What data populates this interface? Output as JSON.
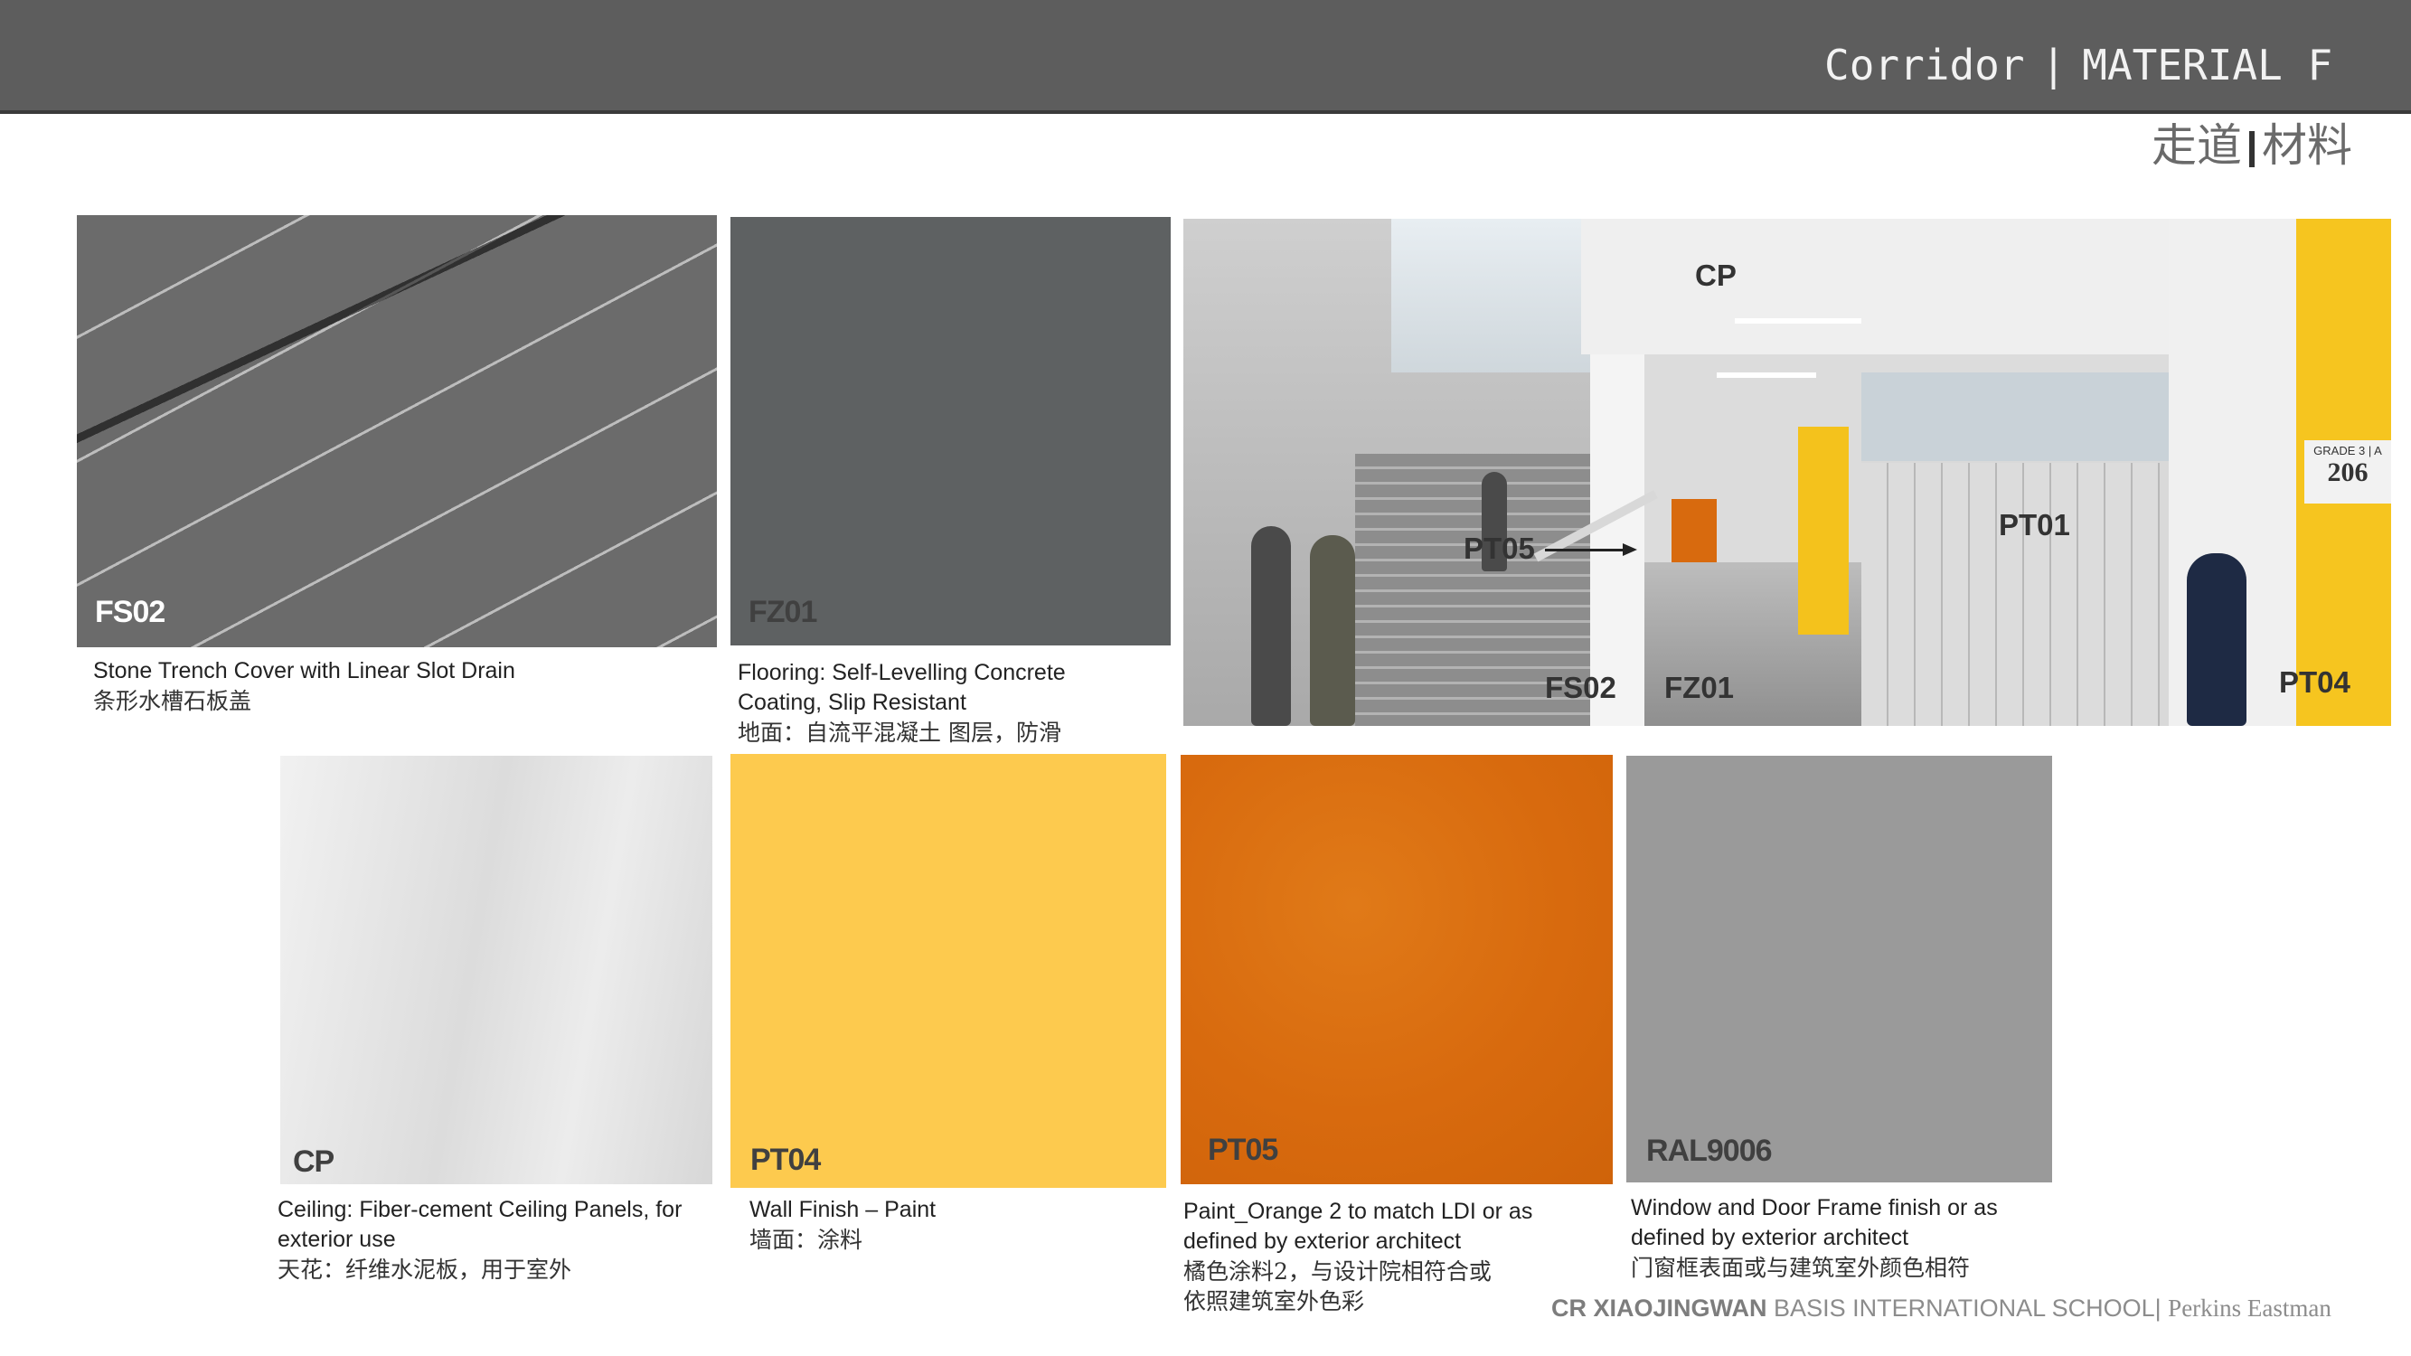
{
  "header": {
    "title_en_a": "Corridor",
    "title_sep": "|",
    "title_en_b": "MATERIAL FINISH",
    "title_cn_a": "走道",
    "title_cn_b": "材料"
  },
  "materials": [
    {
      "code": "FS02",
      "caption_en": "Stone Trench Cover with Linear Slot Drain",
      "caption_cn": "条形水槽石板盖"
    },
    {
      "code": "FZ01",
      "caption_en_1": "Flooring:   Self-Levelling Concrete",
      "caption_en_2": "Coating, Slip Resistant",
      "caption_cn": "地面：自流平混凝土 图层，防滑"
    },
    {
      "code": "CP",
      "caption_en_1": "Ceiling: Fiber-cement Ceiling Panels, for",
      "caption_en_2": "exterior use",
      "caption_cn": "天花：纤维水泥板，用于室外"
    },
    {
      "code": "PT04",
      "caption_en": "Wall Finish – Paint",
      "caption_cn": "墙面：涂料"
    },
    {
      "code": "PT05",
      "caption_en_1": "Paint_Orange 2 to match LDI or as",
      "caption_en_2": "defined by exterior architect",
      "caption_cn_1": "橘色涂料2，与设计院相符合或",
      "caption_cn_2": "依照建筑室外色彩"
    },
    {
      "code": "RAL9006",
      "caption_en_1": "Window and Door Frame finish or as",
      "caption_en_2": "defined by exterior architect",
      "caption_cn": "门窗框表面或与建筑室外颜色相符"
    }
  ],
  "photo": {
    "labels": {
      "cp": "CP",
      "pt05": "PT05",
      "pt01": "PT01",
      "fs02": "FS02",
      "fz01": "FZ01",
      "pt04": "PT04"
    },
    "sign_grade": "GRADE 3 | A",
    "sign_room": "206"
  },
  "footer": {
    "part1": "CR XIAOJINGWAN",
    "part2": "BASIS INTERNATIONAL SCHOOL",
    "sep": "|",
    "part3": "Perkins Eastman"
  },
  "colors": {
    "header_bg": "#5d5d5d",
    "pt04_yellow": "#fdca4e",
    "pt05_orange": "#d86a0e",
    "ral9006_gray": "#9a9a9a",
    "fz01_gray": "#5e6162"
  }
}
